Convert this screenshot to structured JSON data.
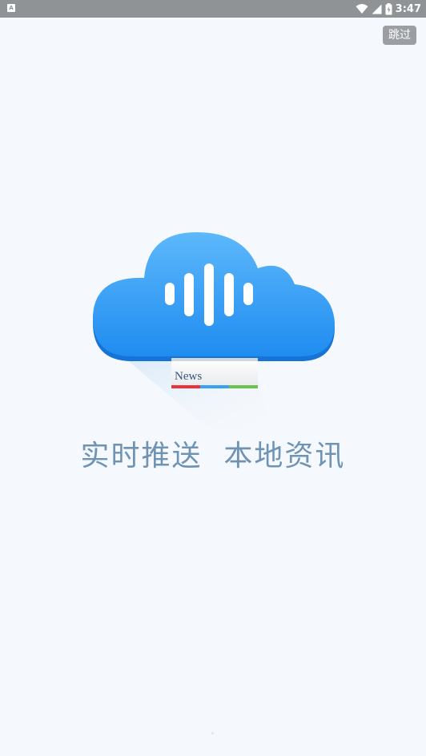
{
  "status_bar": {
    "left_icon": "app-notification-icon",
    "left_icon_glyph": "A",
    "icons": [
      "wifi-icon",
      "signal-icon",
      "battery-charging-icon"
    ],
    "time": "3:47",
    "background": "#8f9396"
  },
  "skip_button": {
    "label": "跳过"
  },
  "logo": {
    "icon": "cloud-voice-news-logo",
    "news_label": "News",
    "cloud_color": "#2f9bf5",
    "stripe_colors": [
      "#e8333c",
      "#3ba0f4",
      "#6cc24a"
    ]
  },
  "tagline": "实时推送  本地资讯"
}
